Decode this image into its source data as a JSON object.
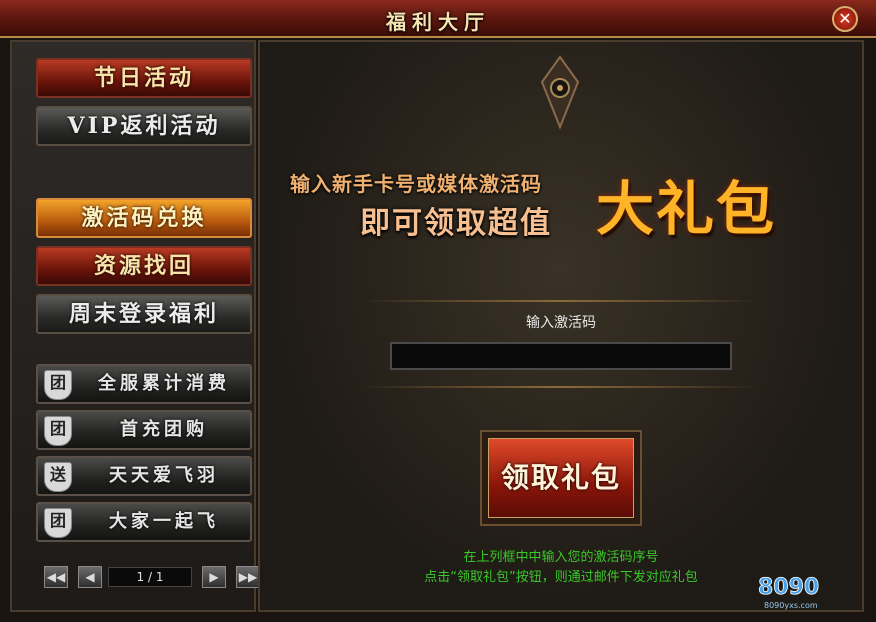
{
  "window": {
    "title": "福利大厅",
    "close_label": "✕"
  },
  "sidebar": {
    "top_buttons": [
      {
        "label": "节日活动"
      },
      {
        "label": "VIP返利活动"
      },
      {
        "label": "激活码兑换"
      },
      {
        "label": "资源找回"
      },
      {
        "label": "周末登录福利"
      }
    ],
    "group_buttons": [
      {
        "badge": "团",
        "label": "全服累计消费"
      },
      {
        "badge": "团",
        "label": "首充团购"
      },
      {
        "badge": "送",
        "label": "天天爱飞羽"
      },
      {
        "badge": "团",
        "label": "大家一起飞"
      }
    ],
    "pager": {
      "page_text": "1 / 1",
      "first": "◀◀",
      "prev": "◀",
      "next": "▶",
      "last": "▶▶"
    }
  },
  "main": {
    "slogan_line1": "输入新手卡号或媒体激活码",
    "slogan_line2": "即可领取超值",
    "big_text": "大礼包",
    "input_label": "输入激活码",
    "input_value": "",
    "claim_button": "领取礼包",
    "hint_line1": "在上列框中中输入您的激活码序号",
    "hint_line2": "点击“领取礼包”按钮，则通过邮件下发对应礼包",
    "logo_text": "8090",
    "logo_sub": "8090yxs.com"
  },
  "colors": {
    "accent_red": "#8a2a1c",
    "gold": "#ffb428",
    "hint_green": "#3ac82a"
  }
}
